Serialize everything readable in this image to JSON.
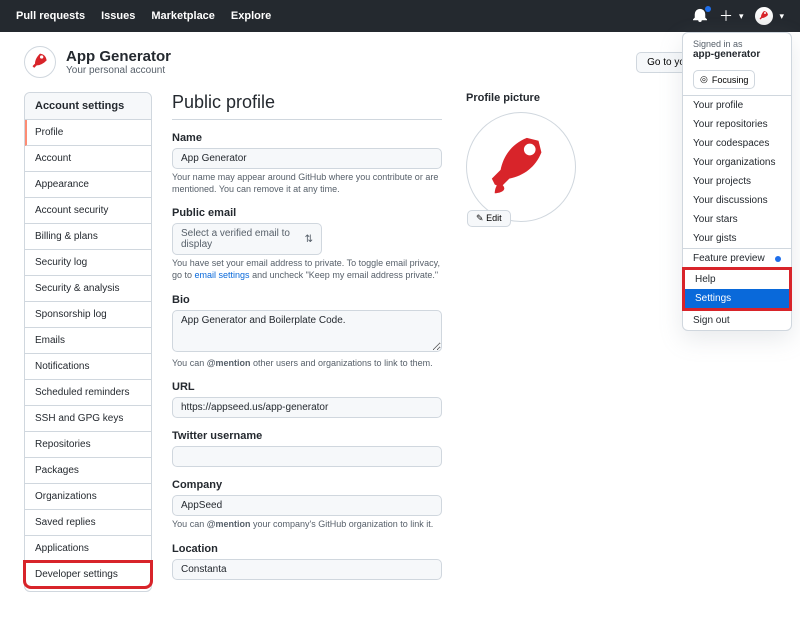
{
  "topbar": {
    "pull_requests": "Pull requests",
    "issues": "Issues",
    "marketplace": "Marketplace",
    "explore": "Explore"
  },
  "header": {
    "title": "App Generator",
    "subtitle": "Your personal account",
    "goto_button": "Go to your personal profile"
  },
  "sidebar": {
    "heading": "Account settings",
    "items": [
      "Profile",
      "Account",
      "Appearance",
      "Account security",
      "Billing & plans",
      "Security log",
      "Security & analysis",
      "Sponsorship log",
      "Emails",
      "Notifications",
      "Scheduled reminders",
      "SSH and GPG keys",
      "Repositories",
      "Packages",
      "Organizations",
      "Saved replies",
      "Applications",
      "Developer settings"
    ]
  },
  "main": {
    "heading": "Public profile",
    "name_label": "Name",
    "name_value": "App Generator",
    "name_help": "Your name may appear around GitHub where you contribute or are mentioned. You can remove it at any time.",
    "email_label": "Public email",
    "email_select": "Select a verified email to display",
    "email_help_pre": "You have set your email address to private. To toggle email privacy, go to ",
    "email_help_link": "email settings",
    "email_help_post": " and uncheck \"Keep my email address private.\"",
    "bio_label": "Bio",
    "bio_value": "App Generator and Boilerplate Code.",
    "bio_help_pre": "You can ",
    "bio_help_bold": "@mention",
    "bio_help_post": " other users and organizations to link to them.",
    "url_label": "URL",
    "url_value": "https://appseed.us/app-generator",
    "twitter_label": "Twitter username",
    "twitter_value": "",
    "company_label": "Company",
    "company_value": "AppSeed",
    "company_help_pre": "You can ",
    "company_help_bold": "@mention",
    "company_help_post": " your company's GitHub organization to link it.",
    "location_label": "Location",
    "location_value": "Constanta"
  },
  "profile_pic": {
    "heading": "Profile picture",
    "edit": "Edit"
  },
  "dropdown": {
    "signed_in": "Signed in as",
    "user": "app-generator",
    "status": "Focusing",
    "items1": [
      "Your profile",
      "Your repositories",
      "Your codespaces",
      "Your organizations",
      "Your projects",
      "Your discussions",
      "Your stars",
      "Your gists"
    ],
    "feature": "Feature preview",
    "help": "Help",
    "settings": "Settings",
    "signout": "Sign out"
  }
}
